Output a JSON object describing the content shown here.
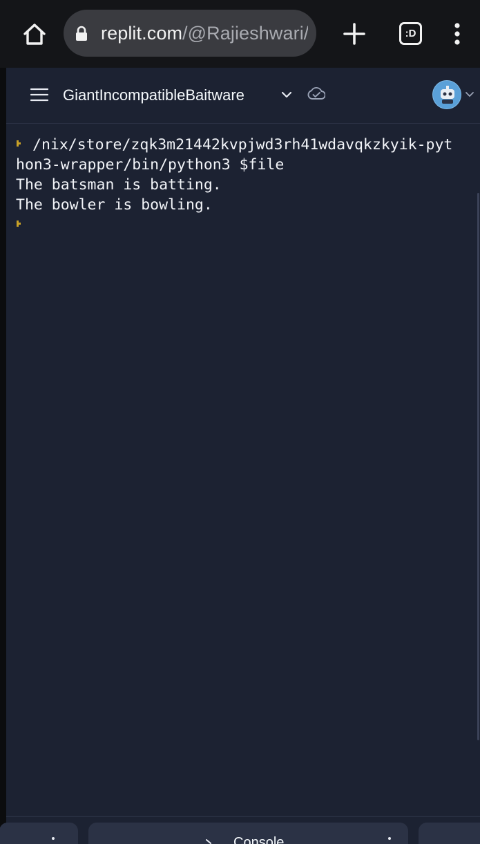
{
  "browser": {
    "url_domain": "replit.com",
    "url_path": "/@Rajieshwari/G",
    "tabs_count_label": ":D",
    "home_icon": "home-icon",
    "lock_icon": "lock-icon",
    "new_tab_icon": "plus-icon",
    "menu_icon": "kebab-menu-icon"
  },
  "header": {
    "project_name": "GiantIncompatibleBaitware",
    "menu_icon": "hamburger-icon",
    "chevron_icon": "chevron-down-icon",
    "status_icon": "cloud-check-icon",
    "avatar_icon": "avatar",
    "accent": "#5aa0d8"
  },
  "console": {
    "lines": [
      "/nix/store/zqk3m21442kvpjwd3rh41wdavqkzkyik-pyt",
      "hon3-wrapper/bin/python3 $file",
      "The batsman is batting.",
      "The bowler is bowling."
    ],
    "prompt_color": "#c9a227"
  },
  "bottom_tabs": {
    "console_label": "Console"
  },
  "colors": {
    "browser_bg": "#141518",
    "url_pill": "#3a3b40",
    "editor_bg": "#1c2232",
    "tab_bg": "#2b3245",
    "text": "#f2f4f8"
  }
}
